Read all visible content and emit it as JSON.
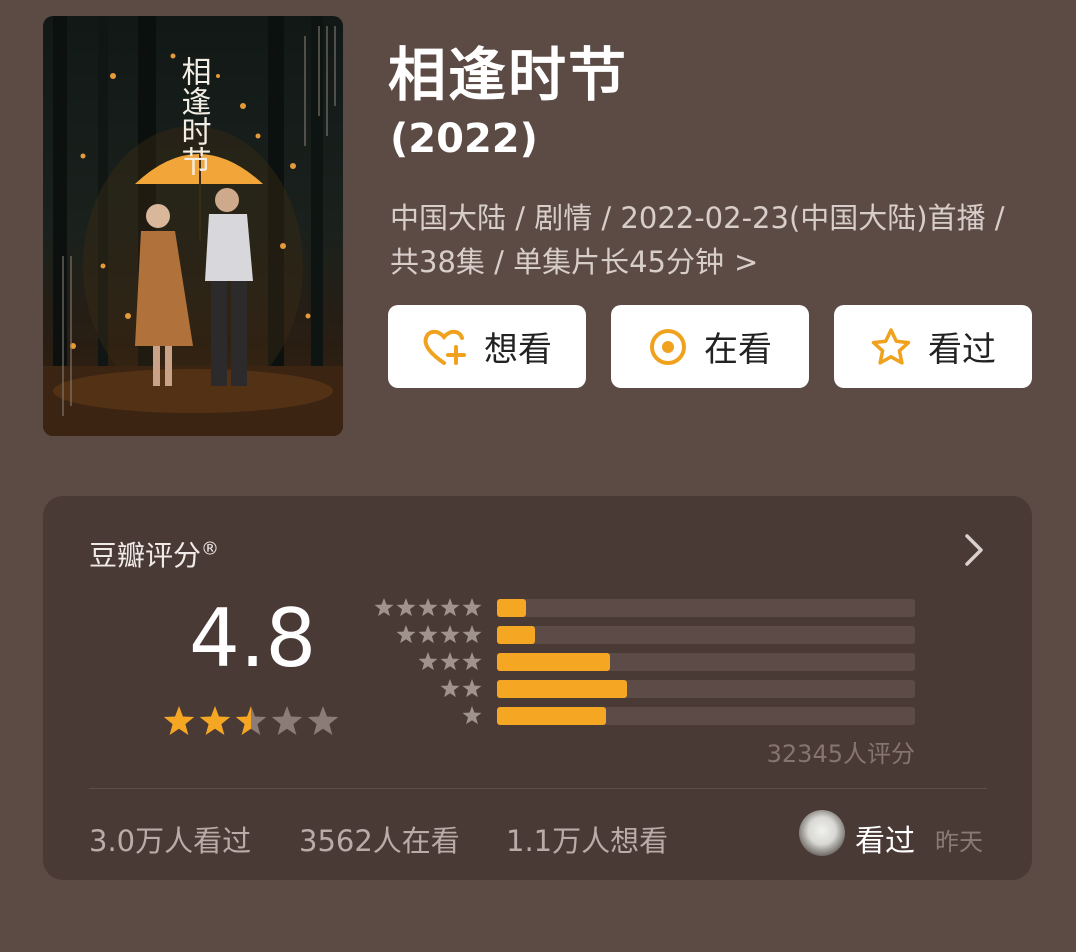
{
  "movie": {
    "title": "相逢时节",
    "year": "(2022)",
    "meta": "中国大陆 / 剧情 / 2022-02-23(中国大陆)首播 / 共38集 / 单集片长45分钟",
    "meta_chevron": ">"
  },
  "poster": {
    "title_text": "相逢时节"
  },
  "actions": [
    {
      "label": "想看",
      "icon": "heart-plus-icon"
    },
    {
      "label": "在看",
      "icon": "target-circle-icon"
    },
    {
      "label": "看过",
      "icon": "star-outline-icon"
    }
  ],
  "rating": {
    "title": "豆瓣评分",
    "registered": "®",
    "score": "4.8",
    "main_stars": 2.5,
    "distribution": [
      {
        "stars": 5,
        "fraction": 0.07
      },
      {
        "stars": 4,
        "fraction": 0.09
      },
      {
        "stars": 3,
        "fraction": 0.27
      },
      {
        "stars": 2,
        "fraction": 0.31
      },
      {
        "stars": 1,
        "fraction": 0.26
      }
    ],
    "count": "32345人评分",
    "colors": {
      "accent": "#f5a623",
      "track": "#5c4b46",
      "dim_star": "#8c7c77"
    }
  },
  "stats": {
    "watched": "3.0万人看过",
    "watching": "3562人在看",
    "want": "1.1万人想看"
  },
  "friend": {
    "status": "看过",
    "time": "昨天"
  }
}
